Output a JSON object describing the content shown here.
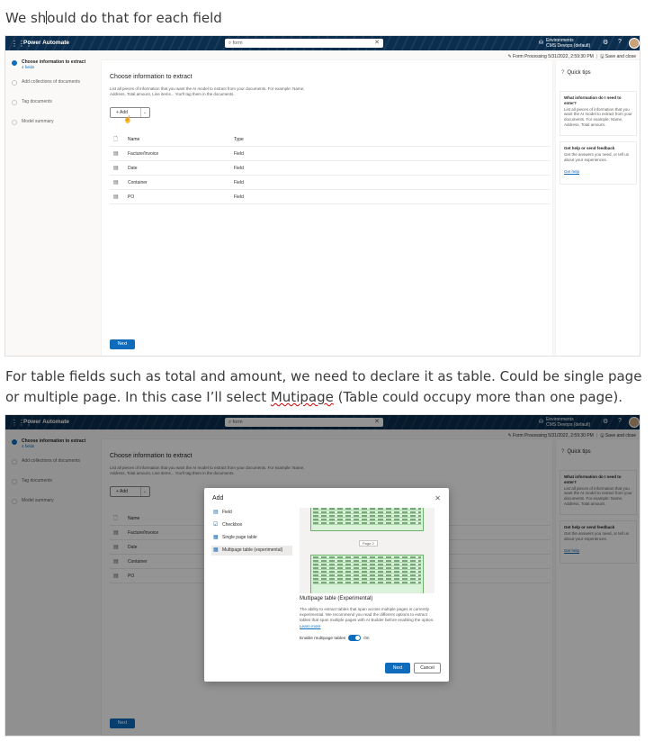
{
  "captions": {
    "first_before": "We sh",
    "first_after": "ould do that for each field",
    "second_before": "For table fields such as total and amount, we need to declare it as table. Could be single page or multiple page. In this case I’ll select ",
    "second_misspelled": "Mutipage",
    "second_after": " (Table could occupy more than one page)."
  },
  "app": {
    "waffle_icon": "waffle-icon",
    "brand": "Power Automate",
    "search_placeholder": "form",
    "environment_label": "Environments",
    "environment_name": "CMS Devops (default)",
    "save_status": "Form Processing 5/31/2022, 2:59:30 PM",
    "save_and_close": "Save and close"
  },
  "steps": [
    {
      "label": "Choose information to extract",
      "sub": "4 fields"
    },
    {
      "label": "Add collections of documents",
      "sub": ""
    },
    {
      "label": "Tag documents",
      "sub": ""
    },
    {
      "label": "Model summary",
      "sub": ""
    }
  ],
  "main": {
    "title": "Choose information to extract",
    "description": "List all pieces of information that you want the AI model to extract from your documents. For example: Name, Address, Total amount, Line items... You'll tag them in the documents.",
    "add_label": "+ Add",
    "next_label": "Next",
    "columns": [
      "Name",
      "Type"
    ],
    "rows": [
      {
        "name": "Facture/Invoice",
        "type": "Field"
      },
      {
        "name": "Date",
        "type": "Field"
      },
      {
        "name": "Container",
        "type": "Field"
      },
      {
        "name": "PO",
        "type": "Field"
      }
    ]
  },
  "side": {
    "title": "Quick tips",
    "card1_title": "What information do I need to enter?",
    "card1_body": "List all pieces of information that you want the AI model to extract from your documents. For example: Name, Address, Total amount.",
    "card2_title": "Get help or send feedback",
    "card2_body": "Get the answers you need, or tell us about your experiences.",
    "card2_link": "Get help"
  },
  "dialog": {
    "title": "Add",
    "options": [
      "Field",
      "Checkbox",
      "Single page table",
      "Multipage table (experimental)"
    ],
    "page_badge": "Page 2",
    "section_title": "Multipage table (Experimental)",
    "body": "The ability to extract tables that span across multiple pages is currently experimental. We recommend you read the different options to extract tables that span multiple pages with AI Builder before enabling the option.",
    "learn_more": "Learn more",
    "toggle_label": "Enable multipage tables",
    "toggle_state": "On",
    "next_label": "Next",
    "cancel_label": "Cancel"
  }
}
